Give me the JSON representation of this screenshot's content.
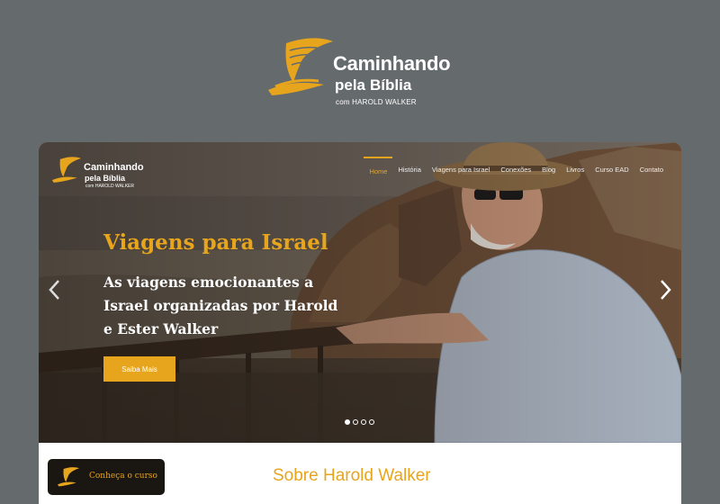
{
  "brand": {
    "line1": "Caminhando",
    "line2a": "pela",
    "line2b": "Bíblia",
    "line3": "com HAROLD WALKER"
  },
  "site": {
    "logo": {
      "line1": "Caminhando",
      "line2": "pela Bíblia",
      "line3": "com HAROLD WALKER"
    },
    "nav": [
      "Home",
      "História",
      "Viagens para Israel",
      "Conexões",
      "Blog",
      "Livros",
      "Curso EAD",
      "Contato"
    ],
    "hero": {
      "title": "Viagens para Israel",
      "subtitle": "As viagens emocionantes a Israel organizadas por Harold e Ester Walker",
      "button": "Saiba Mais"
    },
    "course_button": "Conheça o curso",
    "about_title": "Sobre Harold Walker"
  },
  "colors": {
    "accent": "#e7a51e",
    "background": "#656a6c"
  },
  "icons": {
    "prev": "chevron-left-icon",
    "next": "chevron-right-icon",
    "logo": "ship-sail-logo-icon"
  }
}
